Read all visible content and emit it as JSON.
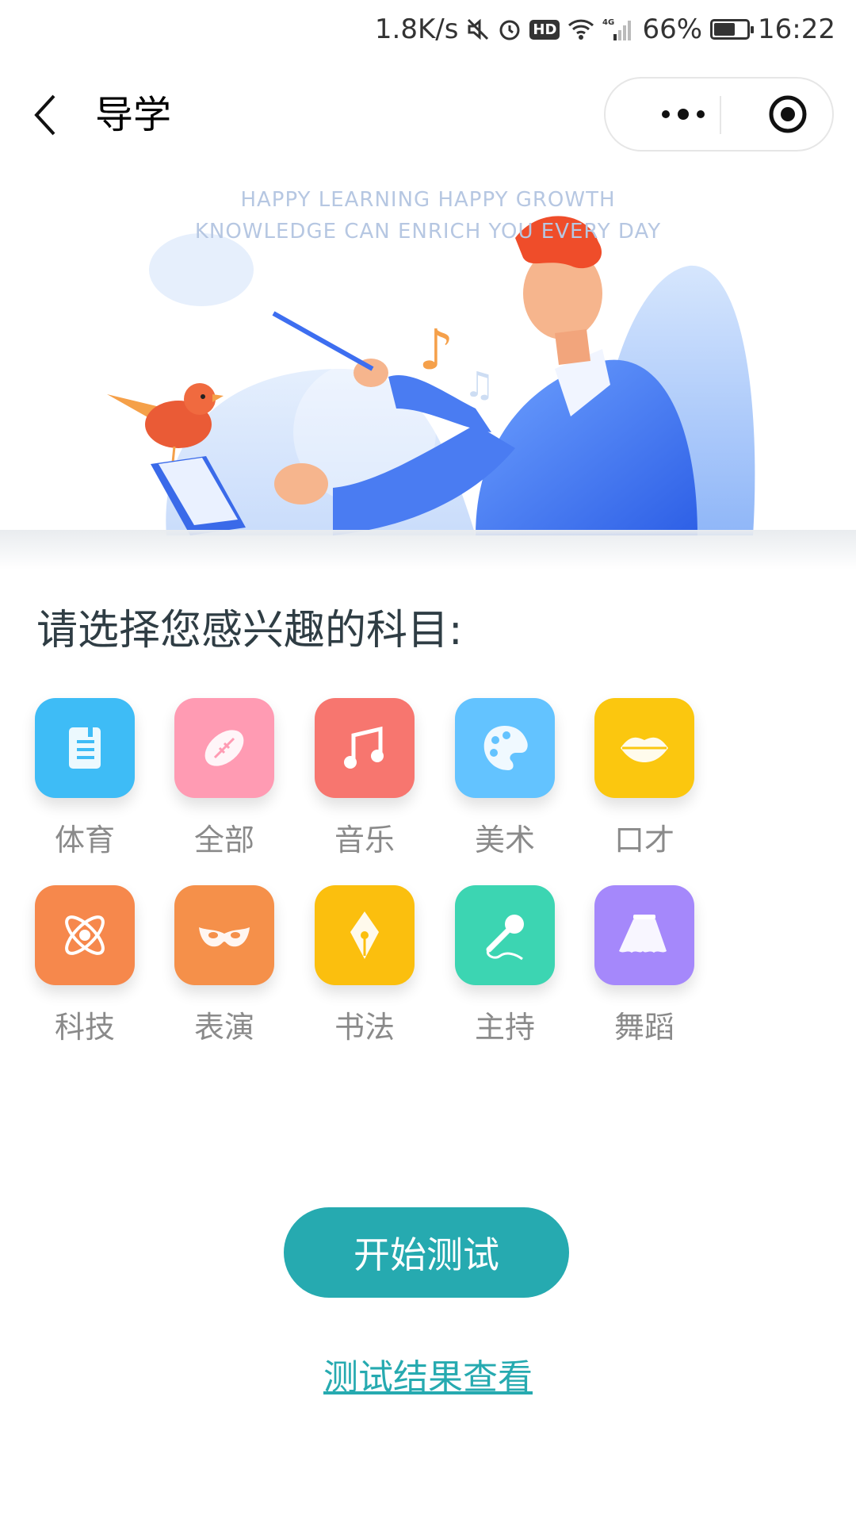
{
  "status_bar": {
    "net_speed": "1.8K/s",
    "hd": "HD",
    "network": "4G",
    "battery_percent": "66%",
    "battery_level": 0.66,
    "time": "16:22"
  },
  "nav": {
    "title": "导学",
    "icons": [
      "back-icon",
      "more-icon",
      "target-icon"
    ]
  },
  "banner": {
    "line1": "HAPPY LEARNING HAPPY GROWTH",
    "line2": "KNOWLEDGE CAN ENRICH YOU EVERY DAY",
    "slides": 3,
    "active_slide": 3
  },
  "prompt": "请选择您感兴趣的科目:",
  "subjects": [
    {
      "label": "体育",
      "icon": "book-icon",
      "color": "#3ebcf6"
    },
    {
      "label": "全部",
      "icon": "football-icon",
      "color": "#ff9bb3"
    },
    {
      "label": "音乐",
      "icon": "music-note-icon",
      "color": "#f7766f"
    },
    {
      "label": "美术",
      "icon": "palette-icon",
      "color": "#63c3ff"
    },
    {
      "label": "口才",
      "icon": "lips-icon",
      "color": "#fbc70f"
    },
    {
      "label": "科技",
      "icon": "atom-icon",
      "color": "#f6884c"
    },
    {
      "label": "表演",
      "icon": "mask-icon",
      "color": "#f5904a"
    },
    {
      "label": "书法",
      "icon": "pen-nib-icon",
      "color": "#fbbf0e"
    },
    {
      "label": "主持",
      "icon": "microphone-icon",
      "color": "#3cd5b2"
    },
    {
      "label": "舞蹈",
      "icon": "skirt-icon",
      "color": "#a588fb"
    }
  ],
  "actions": {
    "start": "开始测试",
    "result": "测试结果查看"
  }
}
